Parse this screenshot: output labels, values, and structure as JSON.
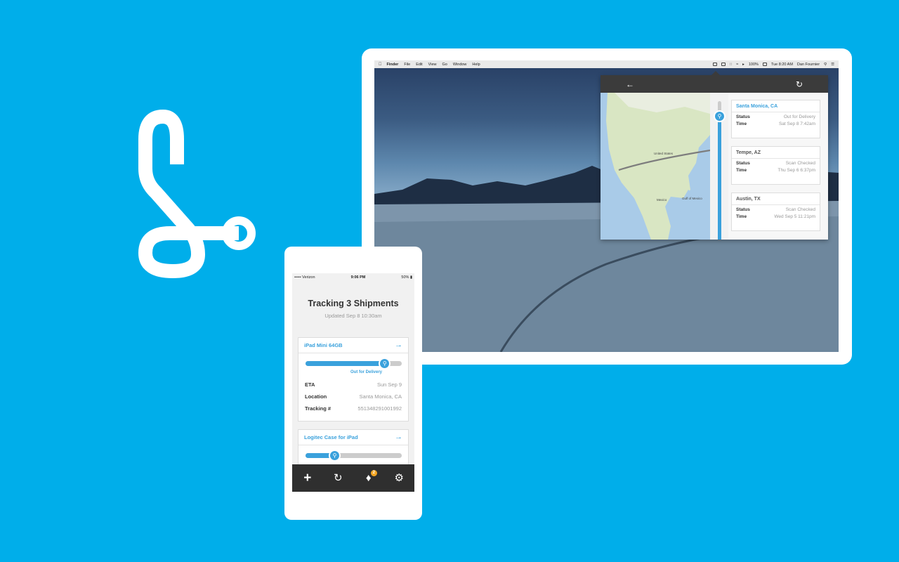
{
  "colors": {
    "background": "#00aeea",
    "accent": "#3aa1dc",
    "dark_bar": "#3b3b3b",
    "badge": "#f5a623"
  },
  "logo": {
    "icon": "slice-logo-icon"
  },
  "menubar": {
    "apple_icon": "apple-icon",
    "app_name": "Finder",
    "items": [
      "File",
      "Edit",
      "View",
      "Go",
      "Window",
      "Help"
    ],
    "battery": "100%",
    "clock": "Tue 8:20 AM",
    "user": "Dan Fournier"
  },
  "popover": {
    "back_icon": "arrow-left-icon",
    "refresh_icon": "refresh-icon",
    "map_labels": {
      "country": "United States",
      "mexico": "Mexico",
      "gulf": "Gulf of Mexico"
    },
    "events": [
      {
        "location": "Santa Monica, CA",
        "status_label": "Status",
        "status": "Out for Delivery",
        "time_label": "Time",
        "time": "Sat Sep 8 7:42am"
      },
      {
        "location": "Tempe, AZ",
        "status_label": "Status",
        "status": "Scan Checked",
        "time_label": "Time",
        "time": "Thu Sep 6 6:37pm"
      },
      {
        "location": "Austin, TX",
        "status_label": "Status",
        "status": "Scan Checked",
        "time_label": "Time",
        "time": "Wed Sep 5 11:21pm"
      }
    ]
  },
  "phone": {
    "carrier": "Verizon",
    "time": "9:06 PM",
    "battery": "50%",
    "title": "Tracking 3 Shipments",
    "updated": "Updated Sep 8 10:30am",
    "shipments": [
      {
        "name": "iPad Mini 64GB",
        "progress": 0.82,
        "status": "Out for Delivery",
        "details": [
          {
            "label": "ETA",
            "value": "Sun Sep 9"
          },
          {
            "label": "Location",
            "value": "Santa Monica, CA"
          },
          {
            "label": "Tracking #",
            "value": "551348291001992"
          }
        ]
      },
      {
        "name": "Logitec Case for iPad",
        "progress": 0.3
      }
    ],
    "tabbar": {
      "add_icon": "plus-icon",
      "refresh_icon": "refresh-icon",
      "bell_icon": "bell-icon",
      "notification_count": "2",
      "settings_icon": "gear-icon"
    }
  }
}
